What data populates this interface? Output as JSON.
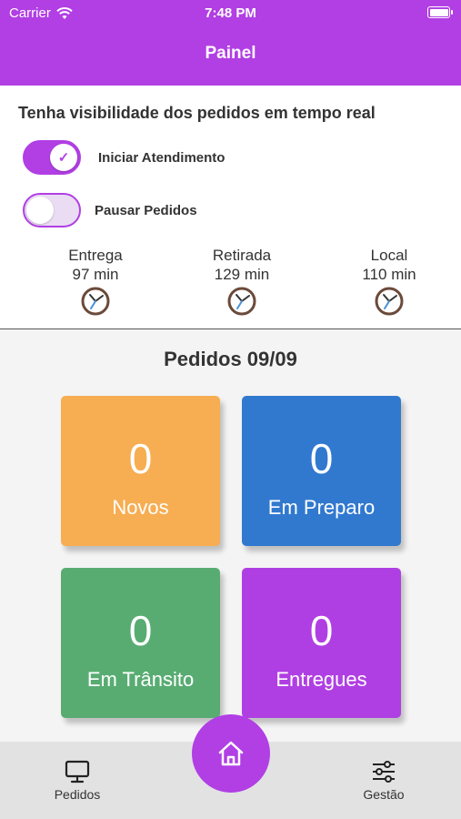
{
  "status_bar": {
    "carrier": "Carrier",
    "time": "7:48 PM"
  },
  "header": {
    "title": "Painel"
  },
  "panel": {
    "subtitle": "Tenha visibilidade dos pedidos em tempo real",
    "toggles": [
      {
        "label": "Iniciar  Atendimento",
        "on": true
      },
      {
        "label": "Pausar  Pedidos",
        "on": false
      }
    ],
    "times": [
      {
        "label": "Entrega",
        "value": "97 min"
      },
      {
        "label": "Retirada",
        "value": "129 min"
      },
      {
        "label": "Local",
        "value": "110 min"
      }
    ]
  },
  "orders": {
    "title": "Pedidos 09/09",
    "cards": [
      {
        "count": "0",
        "label": "Novos",
        "color": "#f7ad51"
      },
      {
        "count": "0",
        "label": "Em Preparo",
        "color": "#3179cf"
      },
      {
        "count": "0",
        "label": "Em Trânsito",
        "color": "#58ac72"
      },
      {
        "count": "0",
        "label": "Entregues",
        "color": "#b03fe3"
      }
    ]
  },
  "nav": {
    "items": [
      {
        "label": "Pedidos",
        "icon": "monitor-icon"
      },
      {
        "label": "Gestão",
        "icon": "sliders-icon"
      }
    ],
    "center_icon": "home-icon"
  },
  "colors": {
    "brand": "#b13fe4"
  }
}
